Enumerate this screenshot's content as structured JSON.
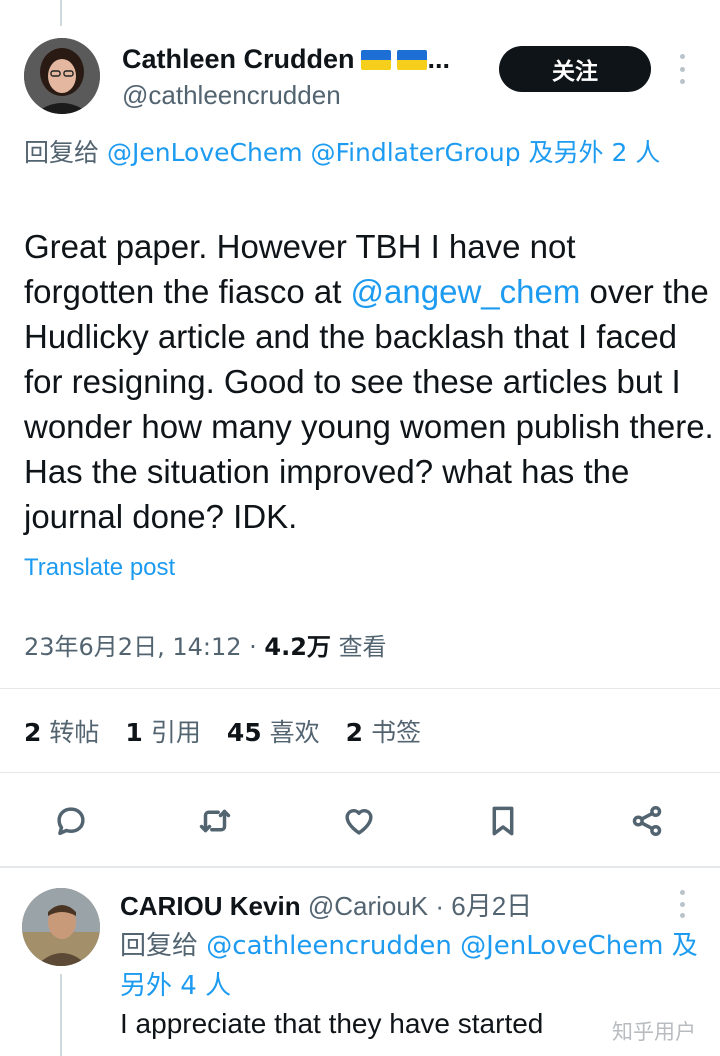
{
  "tweet": {
    "display_name": "Cathleen Crudden",
    "name_ellipsis": "...",
    "handle": "@cathleencrudden",
    "follow_label": "关注",
    "reply_prefix": "回复给",
    "reply_mention_1": "@JenLoveChem",
    "reply_mention_2": "@FindlaterGroup",
    "reply_suffix": "及另外 2 人",
    "text_part_1": "Great paper. However TBH I have not forgotten the fiasco at ",
    "text_mention": "@angew_chem",
    "text_part_2": " over the Hudlicky article and the backlash that I faced for resigning. Good to see these articles but I wonder how many young women publish there. Has the situation improved? what has the journal done? IDK.",
    "translate_label": "Translate post",
    "timestamp": "23年6月2日, 14:12 ·",
    "views_count": "4.2万",
    "views_label": "查看",
    "stats": {
      "reposts_count": "2",
      "reposts_label": "转帖",
      "quotes_count": "1",
      "quotes_label": "引用",
      "likes_count": "45",
      "likes_label": "喜欢",
      "bookmarks_count": "2",
      "bookmarks_label": "书签"
    },
    "actions": [
      "reply-icon",
      "repost-icon",
      "like-icon",
      "bookmark-icon",
      "share-icon"
    ]
  },
  "reply": {
    "display_name": "CARIOU Kevin",
    "handle_date": "@CariouK · 6月2日",
    "reply_prefix": "回复给",
    "reply_mention_1": "@cathleencrudden",
    "reply_mention_2": "@JenLoveChem",
    "reply_suffix": "及另外 4 人",
    "text": "I appreciate that they have started"
  },
  "watermark": "知乎用户",
  "colors": {
    "link": "#1d9bf0",
    "secondary_text": "#536471",
    "primary_text": "#0f1419",
    "follow_bg": "#0f1419"
  }
}
